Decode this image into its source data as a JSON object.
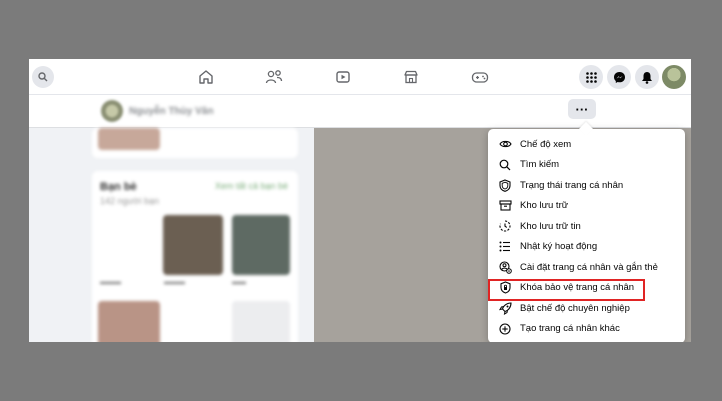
{
  "profile": {
    "name": "Nguyễn Thùy Vân"
  },
  "friends": {
    "title": "Bạn bè",
    "count": "142 người bạn",
    "link": "Xem tất cả bạn bè"
  },
  "more_button": {
    "label": "···"
  },
  "menu": {
    "items": [
      {
        "label": "Chế độ xem",
        "icon": "eye-icon"
      },
      {
        "label": "Tìm kiếm",
        "icon": "search-icon"
      },
      {
        "label": "Trạng thái trang cá nhân",
        "icon": "shield-status-icon"
      },
      {
        "label": "Kho lưu trữ",
        "icon": "archive-box-icon"
      },
      {
        "label": "Kho lưu trữ tin",
        "icon": "story-archive-icon"
      },
      {
        "label": "Nhật ký hoạt động",
        "icon": "activity-list-icon"
      },
      {
        "label": "Cài đặt trang cá nhân và gắn thẻ",
        "icon": "profile-settings-icon"
      },
      {
        "label": "Khóa bảo vệ trang cá nhân",
        "icon": "lock-shield-icon"
      },
      {
        "label": "Bật chế độ chuyên nghiệp",
        "icon": "professional-mode-icon"
      },
      {
        "label": "Tạo trang cá nhân khác",
        "icon": "plus-circle-icon"
      }
    ],
    "highlighted_item": "Khóa bảo vệ trang cá nhân"
  },
  "colors": {
    "highlight_border": "#e02424",
    "menu_bg": "#ffffff",
    "cover": "#a6a29c",
    "page_bg": "#f0f2f5"
  }
}
